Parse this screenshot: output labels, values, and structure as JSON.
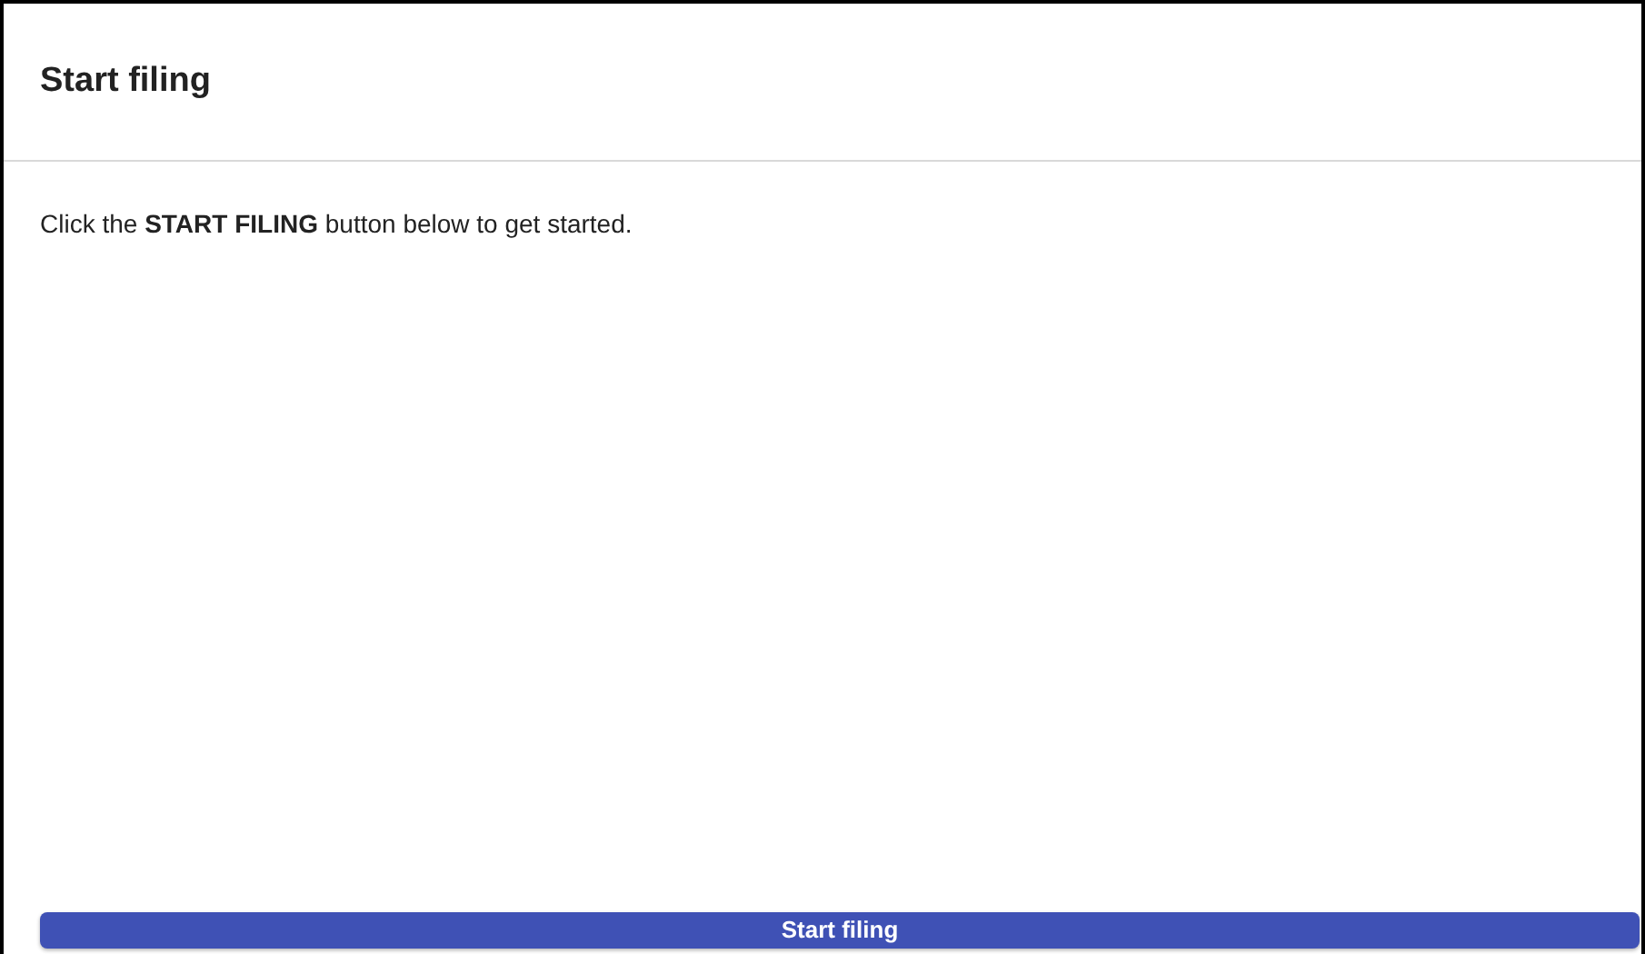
{
  "card": {
    "title": "Start filing",
    "instruction": "Click the **START FILING** button below to get started.",
    "button": "Start filing"
  }
}
